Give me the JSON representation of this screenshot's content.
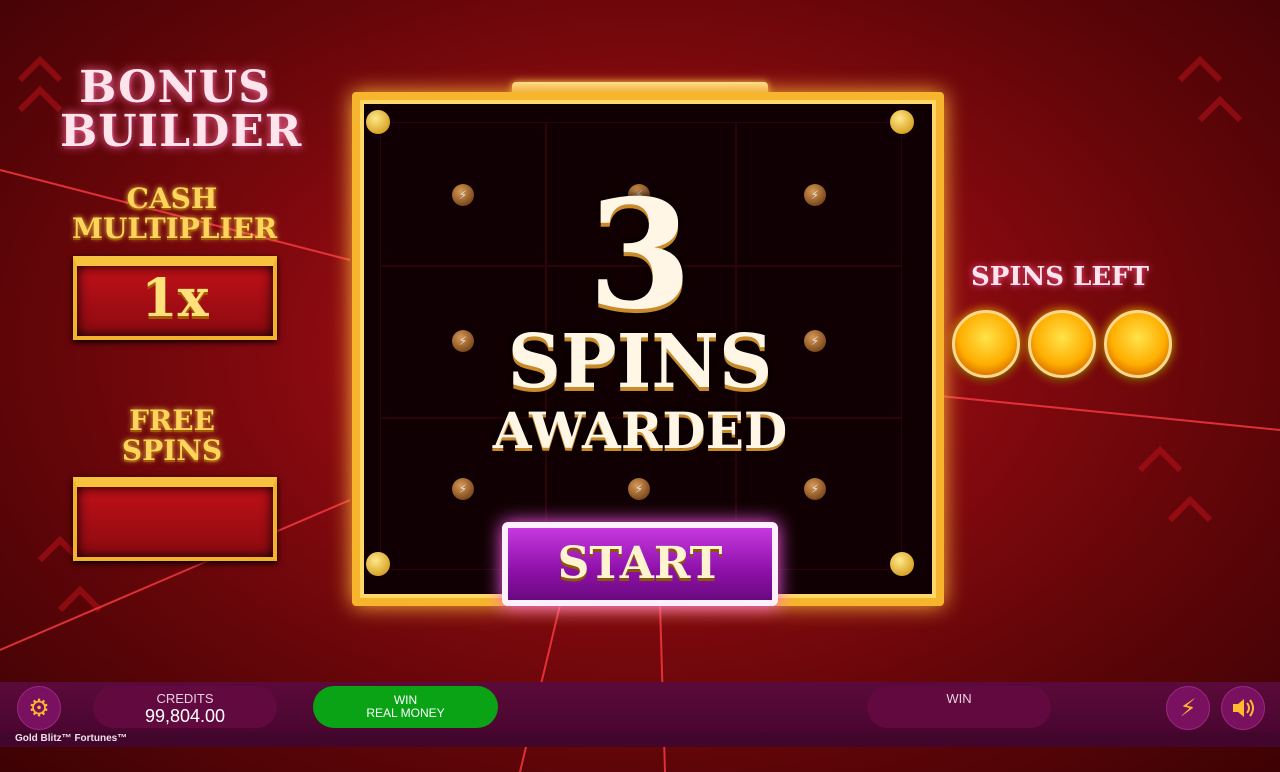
{
  "left_panel": {
    "title_line1": "BONUS",
    "title_line2": "BUILDER",
    "cash_label_line1": "CASH",
    "cash_label_line2": "MULTIPLIER",
    "cash_multiplier_value": "1x",
    "free_label_line1": "FREE",
    "free_label_line2": "SPINS",
    "free_spins_value": ""
  },
  "center": {
    "awarded_count": "3",
    "spins_word": "SPINS",
    "awarded_word": "AWARDED",
    "start_label": "START"
  },
  "right_panel": {
    "spins_left_label": "SPINS LEFT",
    "spins_left_count": 3
  },
  "bottom_bar": {
    "credits_label": "CREDITS",
    "credits_value": "99,804.00",
    "win_real_line1": "WIN",
    "win_real_line2": "REAL MONEY",
    "win_label": "WIN",
    "win_value": "",
    "game_name": "Gold Blitz™ Fortunes™"
  },
  "icons": {
    "settings": "gear-icon",
    "turbo": "lightning-icon",
    "sound": "speaker-icon"
  },
  "colors": {
    "background": "#8a0a10",
    "gold": "#f6b52c",
    "start_button": "#a51cc0",
    "green_button": "#0aa316",
    "bar": "#5b0a3a"
  }
}
